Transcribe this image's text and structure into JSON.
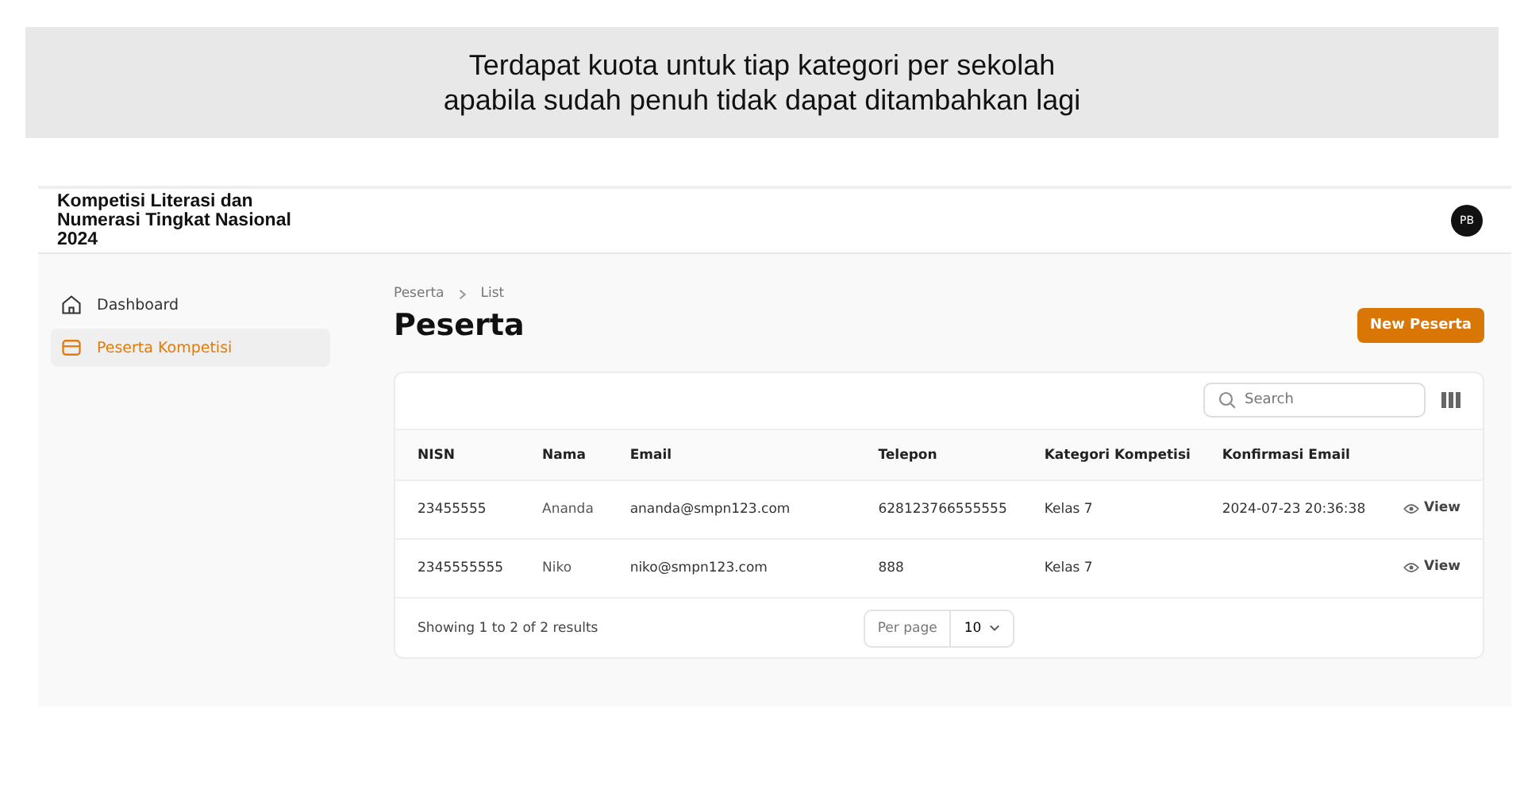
{
  "banner": {
    "lines": [
      "Terdapat kuota untuk tiap kategori per sekolah",
      "apabila sudah penuh tidak dapat ditambahkan lagi"
    ]
  },
  "header": {
    "title": "Kompetisi Literasi dan Numerasi Tingkat Nasional 2024",
    "avatar": "PB"
  },
  "sidebar": {
    "items": [
      {
        "label": "Dashboard",
        "selected": false
      },
      {
        "label": "Peserta Kompetisi",
        "selected": true
      }
    ]
  },
  "breadcrumb": [
    "Peserta",
    "List"
  ],
  "page_title": "Peserta",
  "new_button": "New Peserta",
  "search": {
    "placeholder": "Search"
  },
  "table": {
    "columns": [
      "NISN",
      "Nama",
      "Email",
      "Telepon",
      "Kategori Kompetisi",
      "Konfirmasi Email"
    ],
    "rows": [
      {
        "cells": [
          "23455555",
          "Ananda",
          "ananda@smpn123.com",
          "628123766555555",
          "Kelas 7",
          "2024-07-23 20:36:38"
        ],
        "action": "View"
      },
      {
        "cells": [
          "2345555555",
          "Niko",
          "niko@smpn123.com",
          "888",
          "Kelas 7",
          ""
        ],
        "action": "View"
      }
    ]
  },
  "footer": {
    "summary": "Showing 1 to 2 of 2 results",
    "per_page_label": "Per page",
    "per_page": "10"
  }
}
